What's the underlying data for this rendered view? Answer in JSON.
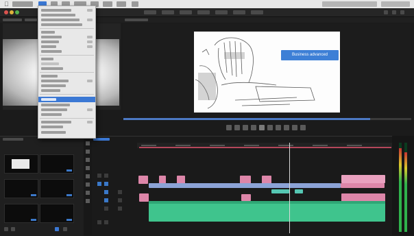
{
  "menubar": {
    "app_menu": "",
    "active_menu": "",
    "items": [
      "",
      "",
      "",
      "",
      "",
      "",
      "",
      ""
    ]
  },
  "window": {
    "title": ""
  },
  "source_monitor": {
    "timecode": ""
  },
  "program_monitor": {
    "timecode": "",
    "title_overlay": "Business advanced"
  },
  "sequence_menu": {
    "highlighted_index": 16
  },
  "timeline": {
    "sequence_tab": ""
  },
  "project_panel": {
    "title": ""
  },
  "colors": {
    "accent": "#3b78d4",
    "video_clip": "#dd86a9",
    "audio_clip": "#3fc48d",
    "timecode": "#3a8fd6"
  }
}
